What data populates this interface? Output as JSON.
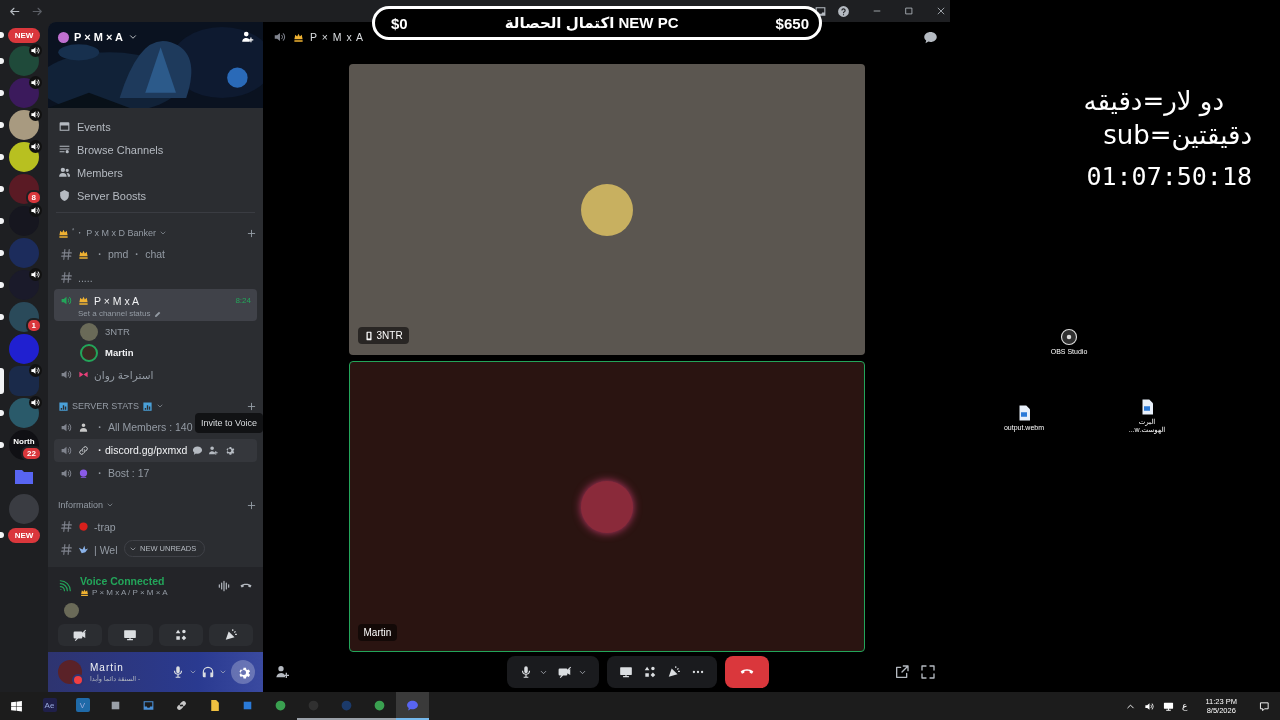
{
  "goal_bar": {
    "start": "$0",
    "label": "اكتمال الحصالة NEW PC",
    "end": "$650"
  },
  "servers": [
    {
      "kind": "pill",
      "label": "NEW"
    },
    {
      "kind": "server",
      "color": "#1f4a3a",
      "speaker": true,
      "unread": true,
      "selected": false
    },
    {
      "kind": "server",
      "color": "#3b1a5c",
      "speaker": true,
      "unread": true,
      "selected": false
    },
    {
      "kind": "server",
      "color": "#a89a80",
      "speaker": true,
      "unread": true,
      "selected": false
    },
    {
      "kind": "server",
      "color": "#b8c020",
      "speaker": true,
      "unread": true,
      "selected": false
    },
    {
      "kind": "server",
      "color": "#5a1a24",
      "speaker": false,
      "badge": "8",
      "unread": true,
      "selected": false
    },
    {
      "kind": "server",
      "color": "#16161f",
      "speaker": true,
      "unread": true,
      "selected": false
    },
    {
      "kind": "server",
      "color": "#1c2c5c",
      "speaker": false,
      "unread": true,
      "selected": false
    },
    {
      "kind": "server",
      "color": "#1a1a2a",
      "speaker": true,
      "unread": true,
      "selected": false
    },
    {
      "kind": "server",
      "color": "#2a4a5a",
      "speaker": false,
      "badge": "1",
      "unread": true,
      "selected": false
    },
    {
      "kind": "server",
      "color": "#2020d0",
      "speaker": false,
      "unread": false,
      "selected": false
    },
    {
      "kind": "server",
      "color": "#1a2a4a",
      "speaker": true,
      "unread": false,
      "selected": true
    },
    {
      "kind": "server",
      "color": "#2a5a6a",
      "speaker": true,
      "unread": true,
      "selected": false
    },
    {
      "kind": "server",
      "color": "#101014",
      "speaker": false,
      "label": "North",
      "badge": "22",
      "unread": true,
      "selected": false
    },
    {
      "kind": "folder",
      "color": "#5865f2"
    },
    {
      "kind": "server",
      "color": "#3a3c42",
      "speaker": false,
      "unread": false,
      "selected": false
    },
    {
      "kind": "pill",
      "label": "NEW"
    }
  ],
  "server": {
    "name": "P × M × A"
  },
  "menu": [
    {
      "kind": "events",
      "label": "Events"
    },
    {
      "kind": "browse",
      "label": "Browse Channels"
    },
    {
      "kind": "members",
      "label": "Members"
    },
    {
      "kind": "boosts",
      "label": "Server Boosts"
    }
  ],
  "categories": [
    {
      "name": "ٴ・ P x M x D Banker",
      "emoji": {
        "kind": "crown"
      },
      "channels": [
        {
          "kind": "text",
          "emoji": {
            "kind": "crown"
          },
          "name": "・ pmd ・ chat",
          "selected": false,
          "hovered": false
        },
        {
          "kind": "text",
          "name": ".....",
          "selected": false,
          "hovered": false
        },
        {
          "kind": "voice",
          "emoji": {
            "kind": "crown"
          },
          "name": "P × M x A",
          "selected": true,
          "hovered": false,
          "time": "8:24",
          "status": "Set a channel status",
          "members": [
            {
              "name": "3NTR",
              "speaking": false
            },
            {
              "name": "Martin",
              "speaking": true
            }
          ]
        },
        {
          "kind": "voice",
          "emoji": {
            "kind": "bow"
          },
          "name": "استراحة روان",
          "selected": false,
          "hovered": false
        }
      ]
    },
    {
      "name": "SERVER STATS",
      "emoji": {
        "kind": "chart"
      },
      "channels": [
        {
          "kind": "voice",
          "emoji": {
            "kind": "person"
          },
          "name": "・ All Members : 140",
          "selected": false,
          "hovered": false
        },
        {
          "kind": "voice",
          "emoji": {
            "kind": "link"
          },
          "name": "・discord.gg/pxmxd",
          "selected": false,
          "hovered": true,
          "tooltip": "Invite to Voice"
        },
        {
          "kind": "voice",
          "emoji": {
            "kind": "orb"
          },
          "name": "・ Bost : 17",
          "selected": false,
          "hovered": false
        }
      ]
    },
    {
      "name": "Information",
      "channels": [
        {
          "kind": "text",
          "emoji": {
            "kind": "reddot"
          },
          "name": "-trap",
          "selected": false,
          "hovered": false
        },
        {
          "kind": "text",
          "emoji": {
            "kind": "bird"
          },
          "name": "| Wel",
          "selected": false,
          "hovered": false
        }
      ]
    }
  ],
  "new_unreads": "NEW UNREADS",
  "voice_panel": {
    "title": "Voice Connected",
    "channel": "P × M x A / P × M × A"
  },
  "user": {
    "name": "Martin",
    "status": "السنقة دائما وأبدا -"
  },
  "call": {
    "channel": "P × M x A",
    "tiles": [
      {
        "name": "3NTR",
        "mobile": true,
        "speaking": false
      },
      {
        "name": "Martin",
        "mobile": false,
        "speaking": true
      }
    ]
  },
  "desktop": {
    "lines": [
      "دو لار=دقيقه",
      "sub=دقيقتين"
    ],
    "timer": "01:07:50:18",
    "icons": [
      {
        "kind": "obs",
        "label": "OBS Studio"
      },
      {
        "kind": "video",
        "label": "output.webm"
      },
      {
        "kind": "video",
        "label": "البرت الهوست.w..."
      }
    ]
  },
  "taskbar": {
    "apps": [
      {
        "kind": "ae",
        "label": "Ae",
        "running": false,
        "active": false
      },
      {
        "kind": "v",
        "label": "V",
        "running": false,
        "active": false
      },
      {
        "kind": "calc",
        "running": false,
        "active": false
      },
      {
        "kind": "window",
        "running": false,
        "active": false
      },
      {
        "kind": "link",
        "running": false,
        "active": false
      },
      {
        "kind": "folder",
        "running": false,
        "active": false
      },
      {
        "kind": "store",
        "running": false,
        "active": false
      },
      {
        "kind": "chrome",
        "running": false,
        "active": false
      },
      {
        "kind": "obs",
        "running": true,
        "active": false
      },
      {
        "kind": "steam",
        "running": true,
        "active": false
      },
      {
        "kind": "chrome",
        "running": true,
        "active": false
      },
      {
        "kind": "discord",
        "running": true,
        "active": true
      }
    ],
    "lang": "ع",
    "time": "11:23 PM",
    "date": "8/5/2026"
  }
}
